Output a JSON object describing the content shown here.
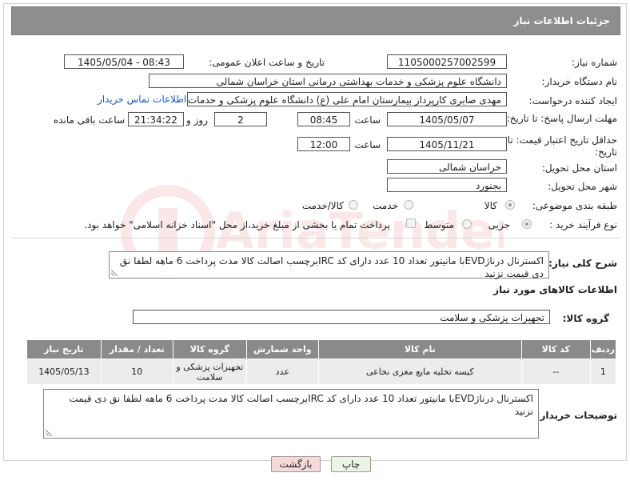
{
  "header": {
    "title": "جزئیات اطلاعات نیاز"
  },
  "fields": {
    "need_number_label": "شماره نیاز:",
    "need_number": "1105000257002599",
    "announce_label": "تاریخ و ساعت اعلان عمومی:",
    "announce_value": "1405/05/04 - 08:43",
    "buyer_org_label": "نام دستگاه خریدار:",
    "buyer_org": "دانشگاه علوم پزشکی و خدمات بهداشتی درمانی استان خراسان شمالی",
    "creator_label": "ایجاد کننده درخواست:",
    "creator": "مهدی صابری کارپرداز بیمارستان امام علی (ع) دانشگاه علوم پزشکی و خدمات ب",
    "contact_link": "اطلاعات تماس خریدار",
    "deadline_label": "مهلت ارسال پاسخ: تا تاریخ:",
    "deadline_date": "1405/05/07",
    "time_label": "ساعت",
    "deadline_time": "08:45",
    "days_value": "2",
    "days_label": "روز و",
    "remaining_time": "21:34:22",
    "remaining_label": "ساعت باقی مانده",
    "validity_label": "حداقل تاریخ اعتبار قیمت: تا تاریخ:",
    "validity_date": "1405/11/21",
    "validity_time": "12:00",
    "province_label": "استان محل تحویل:",
    "province": "خراسان شمالی",
    "city_label": "شهر محل تحویل:",
    "city": "بجنورد",
    "category_label": "طبقه بندی موضوعی:",
    "category_options": [
      "کالا",
      "خدمت",
      "کالا/خدمت"
    ],
    "process_label": "نوع فرآیند خرید :",
    "process_options": [
      "جزیی",
      "متوسط"
    ],
    "payment_note": "پرداخت تمام یا بخشی از مبلغ خرید،از محل \"اسناد خزانه اسلامی\" خواهد بود."
  },
  "description": {
    "label": "شرح کلی نیاز:",
    "text": "اکسترنال درناژEVDبا مانیتور تعداد 10 عدد دارای کد IRCبرچسب اصالت کالا مدت پرداخت 6 ماهه لطفا نق دی قیمت نزنید"
  },
  "goods_info": {
    "title": "اطلاعات کالاهای مورد نیاز",
    "group_label": "گروه کالا:",
    "group_value": "تجهیزات پزشکی و سلامت"
  },
  "table": {
    "headers": [
      "ردیف",
      "کد کالا",
      "نام کالا",
      "واحد شمارش",
      "گروه کالا",
      "تعداد / مقدار",
      "تاریخ نیاز"
    ],
    "rows": [
      [
        "1",
        "--",
        "کیسه تخلیه مایع مغزی نخاعی",
        "عدد",
        "تجهیزات پزشکی و سلامت",
        "10",
        "1405/05/13"
      ]
    ]
  },
  "buyer_notes": {
    "label": "توضیحات خریدار:",
    "text": "اکسترنال درناژEVDبا مانیتور تعداد 10 عدد دارای کد IRCبرچسب اصالت کالا مدت پرداخت 6 ماهه لطفا نق دی قیمت نزنید"
  },
  "buttons": {
    "print": "چاپ",
    "back": "بازگشت"
  },
  "watermark_text": "AriaTender.net",
  "colors": {
    "header_bg": "#8e8e8e",
    "back_button_bg": "#f6d9d9",
    "print_button_bg": "#eaf5e6",
    "link": "#1a5bb8"
  }
}
